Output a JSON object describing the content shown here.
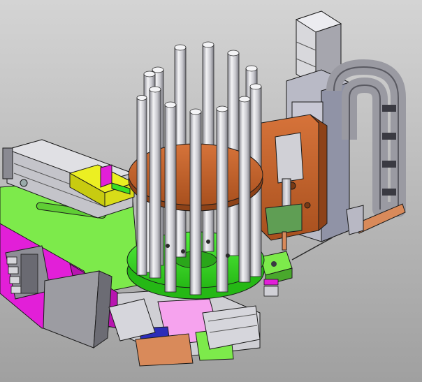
{
  "scene": {
    "background": {
      "top": "#d4d4d4",
      "bottom": "#a0a0a0"
    },
    "colors": {
      "orange": "#c7642a",
      "green": "#39e024",
      "magenta": "#e21fd8",
      "lime": "#7dea4b",
      "yellow": "#ecef22",
      "pink": "#f6a3ee",
      "steel": "#cfcfd4",
      "darksteel": "#707078",
      "copper": "#d98a5a"
    },
    "parts": [
      "stepper-motor",
      "cable-drag-chain",
      "vertical-slide-module",
      "tube-magazine-carousel",
      "pneumatic-slide-cylinder",
      "yellow-clamp-block",
      "green-base-plate",
      "magenta-side-plate",
      "solenoid-valve-bank",
      "lower-slide-cylinders",
      "tube-holder-block"
    ]
  }
}
